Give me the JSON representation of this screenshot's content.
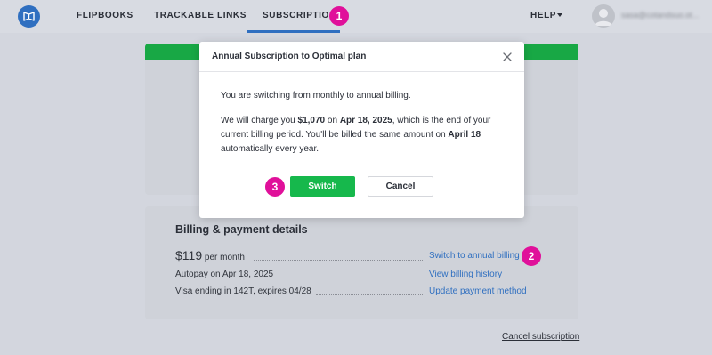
{
  "nav": {
    "items": [
      {
        "label": "FLIPBOOKS"
      },
      {
        "label": "TRACKABLE LINKS"
      },
      {
        "label": "SUBSCRIPTION",
        "active": true
      }
    ],
    "help_label": "HELP",
    "user_email": "sasa@cotandsuo.ot..."
  },
  "badges": [
    "1",
    "2",
    "3"
  ],
  "billing": {
    "title": "Billing & payment details",
    "price": "$119",
    "price_period": "per month",
    "autopay": "Autopay on Apr 18, 2025",
    "card": "Visa ending in 142T, expires 04/28",
    "links": {
      "switch_annual": "Switch to annual billing",
      "view_history": "View billing history",
      "update_payment": "Update payment method"
    },
    "cancel_subscription": "Cancel subscription"
  },
  "modal": {
    "title": "Annual Subscription to Optimal plan",
    "line1": "You are switching from monthly to annual billing.",
    "p2_a": "We will charge you ",
    "amount": "$1,070",
    "p2_b": " on ",
    "date": "Apr 18, 2025",
    "p2_c": ", which is the end of your current billing period. You'll be billed the same amount on ",
    "renew_date": "April 18",
    "p2_d": " automatically every year.",
    "switch_label": "Switch",
    "cancel_label": "Cancel"
  },
  "colors": {
    "accent": "#2f6fc0",
    "success": "#16b84c",
    "badge": "#e0109a"
  }
}
